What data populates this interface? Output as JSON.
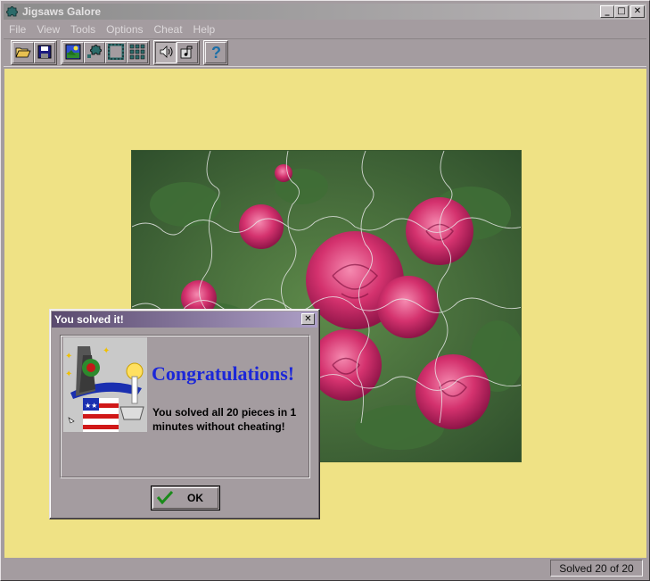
{
  "window": {
    "title": "Jigsaws Galore",
    "icon": "puzzle-piece-icon"
  },
  "title_buttons": {
    "minimize": "_",
    "maximize": "□",
    "close": "✕"
  },
  "menu": [
    "File",
    "View",
    "Tools",
    "Options",
    "Cheat",
    "Help"
  ],
  "toolbar": {
    "groups": [
      [
        "open-folder-icon",
        "save-disk-icon"
      ],
      [
        "picture-icon",
        "scatter-pieces-icon",
        "edge-pieces-icon",
        "grid-pieces-icon"
      ],
      [
        "sound-icon",
        "music-icon"
      ],
      [
        "help-question-icon"
      ]
    ]
  },
  "colors": {
    "workspace": "#efe285",
    "chrome": "#a49ca0",
    "congrats_text": "#1c27d8",
    "dialog_title_gradient": [
      "#5a4a6e",
      "#ad9fc6"
    ]
  },
  "puzzle": {
    "picture": "pink roses photograph",
    "pieces_total": 20
  },
  "dialog": {
    "title": "You solved it!",
    "close": "✕",
    "heading": "Congratulations!",
    "message": "You solved all 20 pieces in 1 minutes without cheating!",
    "ok_label": "OK",
    "image": "wizard-icon"
  },
  "status": {
    "text": "Solved 20 of 20"
  }
}
